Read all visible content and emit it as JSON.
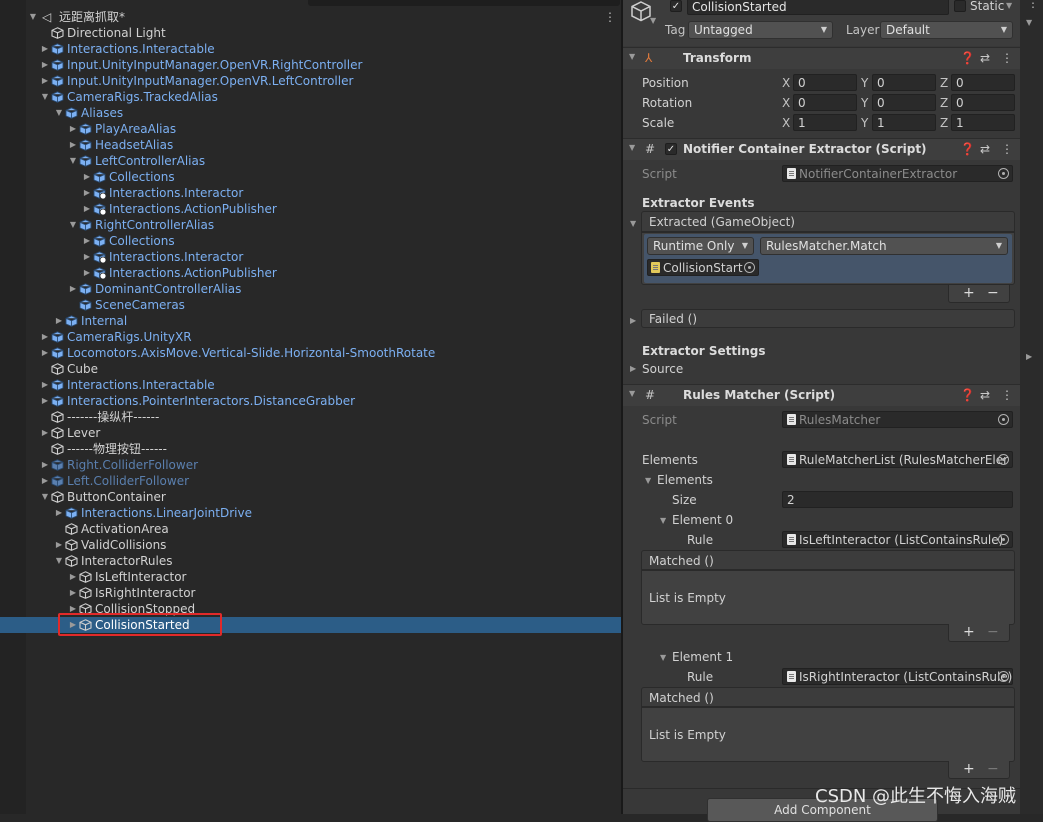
{
  "hierarchy": {
    "scene_name": "远距离抓取*",
    "rows": [
      {
        "label": "Directional Light",
        "depth": 1,
        "arrow": "",
        "type": "normal"
      },
      {
        "label": "Interactions.Interactable",
        "depth": 1,
        "arrow": "right",
        "type": "prefab"
      },
      {
        "label": "Input.UnityInputManager.OpenVR.RightController",
        "depth": 1,
        "arrow": "right",
        "type": "prefab"
      },
      {
        "label": "Input.UnityInputManager.OpenVR.LeftController",
        "depth": 1,
        "arrow": "right",
        "type": "prefab"
      },
      {
        "label": "CameraRigs.TrackedAlias",
        "depth": 1,
        "arrow": "down",
        "type": "prefab"
      },
      {
        "label": "Aliases",
        "depth": 2,
        "arrow": "down",
        "type": "prefab"
      },
      {
        "label": "PlayAreaAlias",
        "depth": 3,
        "arrow": "right",
        "type": "prefab"
      },
      {
        "label": "HeadsetAlias",
        "depth": 3,
        "arrow": "right",
        "type": "prefab"
      },
      {
        "label": "LeftControllerAlias",
        "depth": 3,
        "arrow": "down",
        "type": "prefab"
      },
      {
        "label": "Collections",
        "depth": 4,
        "arrow": "right",
        "type": "prefab"
      },
      {
        "label": "Interactions.Interactor",
        "depth": 4,
        "arrow": "right",
        "type": "prefab-add"
      },
      {
        "label": "Interactions.ActionPublisher",
        "depth": 4,
        "arrow": "right",
        "type": "prefab-add"
      },
      {
        "label": "RightControllerAlias",
        "depth": 3,
        "arrow": "down",
        "type": "prefab"
      },
      {
        "label": "Collections",
        "depth": 4,
        "arrow": "right",
        "type": "prefab"
      },
      {
        "label": "Interactions.Interactor",
        "depth": 4,
        "arrow": "right",
        "type": "prefab-add"
      },
      {
        "label": "Interactions.ActionPublisher",
        "depth": 4,
        "arrow": "right",
        "type": "prefab-add"
      },
      {
        "label": "DominantControllerAlias",
        "depth": 3,
        "arrow": "right",
        "type": "prefab"
      },
      {
        "label": "SceneCameras",
        "depth": 3,
        "arrow": "",
        "type": "prefab"
      },
      {
        "label": "Internal",
        "depth": 2,
        "arrow": "right",
        "type": "prefab"
      },
      {
        "label": "CameraRigs.UnityXR",
        "depth": 1,
        "arrow": "right",
        "type": "prefab"
      },
      {
        "label": "Locomotors.AxisMove.Vertical-Slide.Horizontal-SmoothRotate",
        "depth": 1,
        "arrow": "right",
        "type": "prefab"
      },
      {
        "label": "Cube",
        "depth": 1,
        "arrow": "",
        "type": "normal"
      },
      {
        "label": "Interactions.Interactable",
        "depth": 1,
        "arrow": "right",
        "type": "prefab"
      },
      {
        "label": "Interactions.PointerInteractors.DistanceGrabber",
        "depth": 1,
        "arrow": "right",
        "type": "prefab"
      },
      {
        "label": "-------操纵杆------",
        "depth": 1,
        "arrow": "",
        "type": "normal"
      },
      {
        "label": "Lever",
        "depth": 1,
        "arrow": "right",
        "type": "normal"
      },
      {
        "label": "------物理按钮------",
        "depth": 1,
        "arrow": "",
        "type": "normal"
      },
      {
        "label": "Right.ColliderFollower",
        "depth": 1,
        "arrow": "right",
        "type": "prefab-dim"
      },
      {
        "label": "Left.ColliderFollower",
        "depth": 1,
        "arrow": "right",
        "type": "prefab-dim"
      },
      {
        "label": "ButtonContainer",
        "depth": 1,
        "arrow": "down",
        "type": "normal"
      },
      {
        "label": "Interactions.LinearJointDrive",
        "depth": 2,
        "arrow": "right",
        "type": "prefab"
      },
      {
        "label": "ActivationArea",
        "depth": 2,
        "arrow": "",
        "type": "normal"
      },
      {
        "label": "ValidCollisions",
        "depth": 2,
        "arrow": "right",
        "type": "normal"
      },
      {
        "label": "InteractorRules",
        "depth": 2,
        "arrow": "down",
        "type": "normal"
      },
      {
        "label": "IsLeftInteractor",
        "depth": 3,
        "arrow": "right",
        "type": "normal"
      },
      {
        "label": "IsRightInteractor",
        "depth": 3,
        "arrow": "right",
        "type": "normal"
      },
      {
        "label": "CollisionStopped",
        "depth": 3,
        "arrow": "right",
        "type": "normal"
      },
      {
        "label": "CollisionStarted",
        "depth": 3,
        "arrow": "right",
        "type": "selected"
      }
    ]
  },
  "inspector": {
    "object_name": "CollisionStarted",
    "static_label": "Static",
    "tag_label": "Tag",
    "tag_value": "Untagged",
    "layer_label": "Layer",
    "layer_value": "Default",
    "transform": {
      "title": "Transform",
      "rows": [
        {
          "label": "Position",
          "x": "0",
          "y": "0",
          "z": "0"
        },
        {
          "label": "Rotation",
          "x": "0",
          "y": "0",
          "z": "0"
        },
        {
          "label": "Scale",
          "x": "1",
          "y": "1",
          "z": "1"
        }
      ],
      "axis_x": "X",
      "axis_y": "Y",
      "axis_z": "Z"
    },
    "extractor": {
      "title": "Notifier Container Extractor (Script)",
      "script_label": "Script",
      "script_value": "NotifierContainerExtractor",
      "events_heading": "Extractor Events",
      "extracted_event": "Extracted (GameObject)",
      "runtime_option": "Runtime Only",
      "function_value": "RulesMatcher.Match",
      "target_object": "CollisionStart",
      "failed_event": "Failed ()",
      "settings_heading": "Extractor Settings",
      "source_label": "Source"
    },
    "rules_matcher": {
      "title": "Rules Matcher (Script)",
      "script_label": "Script",
      "script_value": "RulesMatcher",
      "elements_label": "Elements",
      "elements_value": "RuleMatcherList (RulesMatcherEler",
      "elements_fold": "Elements",
      "size_label": "Size",
      "size_value": "2",
      "element0_label": "Element 0",
      "element1_label": "Element 1",
      "rule_label": "Rule",
      "rule0_value": "IsLeftInteractor (ListContainsRule)",
      "rule1_value": "IsRightInteractor (ListContainsRule)",
      "matched_label": "Matched ()",
      "empty_label": "List is Empty"
    },
    "add_component": "Add Component"
  },
  "watermark": "CSDN @此生不悔入海贼",
  "colors": {
    "accent_selected": "#2c5d87",
    "prefab_blue": "#7cb0f2",
    "highlight_box": "#e12a2a"
  }
}
